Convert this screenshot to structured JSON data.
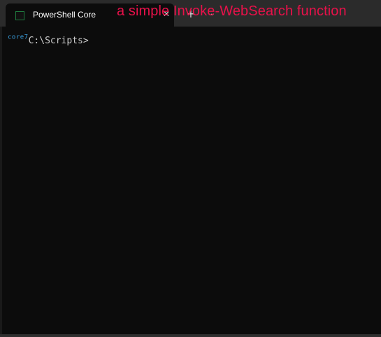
{
  "window": {
    "tab": {
      "title": "PowerShell Core",
      "icon": "powershell-icon",
      "close_glyph": "✕"
    },
    "new_tab_glyph": "+",
    "dropdown_glyph": "⌄"
  },
  "overlay": {
    "caption": "a simple Invoke-WebSearch function",
    "color": "#e8114a"
  },
  "terminal": {
    "prompt_env": "core7",
    "prompt_path": "C:\\Scripts>",
    "background": "#0c0c0c",
    "env_color": "#3aa0e0"
  }
}
